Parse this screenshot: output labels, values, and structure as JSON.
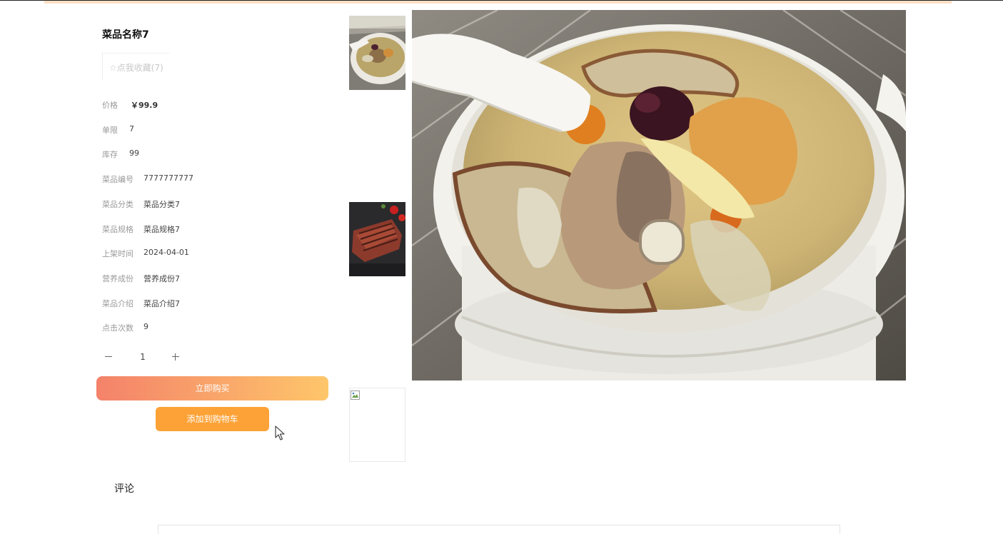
{
  "product": {
    "title": "菜品名称7",
    "favorite_label": "☆点我收藏(7)",
    "fields": [
      {
        "label": "价格",
        "value": "￥99.9"
      },
      {
        "label": "单限",
        "value": "7"
      },
      {
        "label": "库存",
        "value": "99"
      },
      {
        "label": "菜品编号",
        "value": "7777777777"
      },
      {
        "label": "菜品分类",
        "value": "菜品分类7"
      },
      {
        "label": "菜品规格",
        "value": "菜品规格7"
      },
      {
        "label": "上架时间",
        "value": "2024-04-01"
      },
      {
        "label": "营养成份",
        "value": "营养成份7"
      },
      {
        "label": "菜品介绍",
        "value": "菜品介绍7"
      },
      {
        "label": "点击次数",
        "value": "9"
      }
    ]
  },
  "quantity": {
    "value": "1",
    "minus_icon": "minus-icon",
    "plus_icon": "plus-icon"
  },
  "actions": {
    "buy_label": "立即购买",
    "cart_label": "添加到购物车",
    "buy_gradient": [
      "#f4826a",
      "#fec66a"
    ],
    "cart_color": "#fda236"
  },
  "gallery": {
    "thumbnails": [
      {
        "icon": "soup-thumbnail"
      },
      {
        "icon": "steak-thumbnail"
      },
      {
        "icon": "broken-image-icon"
      }
    ],
    "main_image": "soup-bowl-photo"
  },
  "comments": {
    "title": "评论"
  },
  "colors": {
    "accent_bar": "#fbe0c6",
    "muted_label": "#9a9a9a"
  }
}
